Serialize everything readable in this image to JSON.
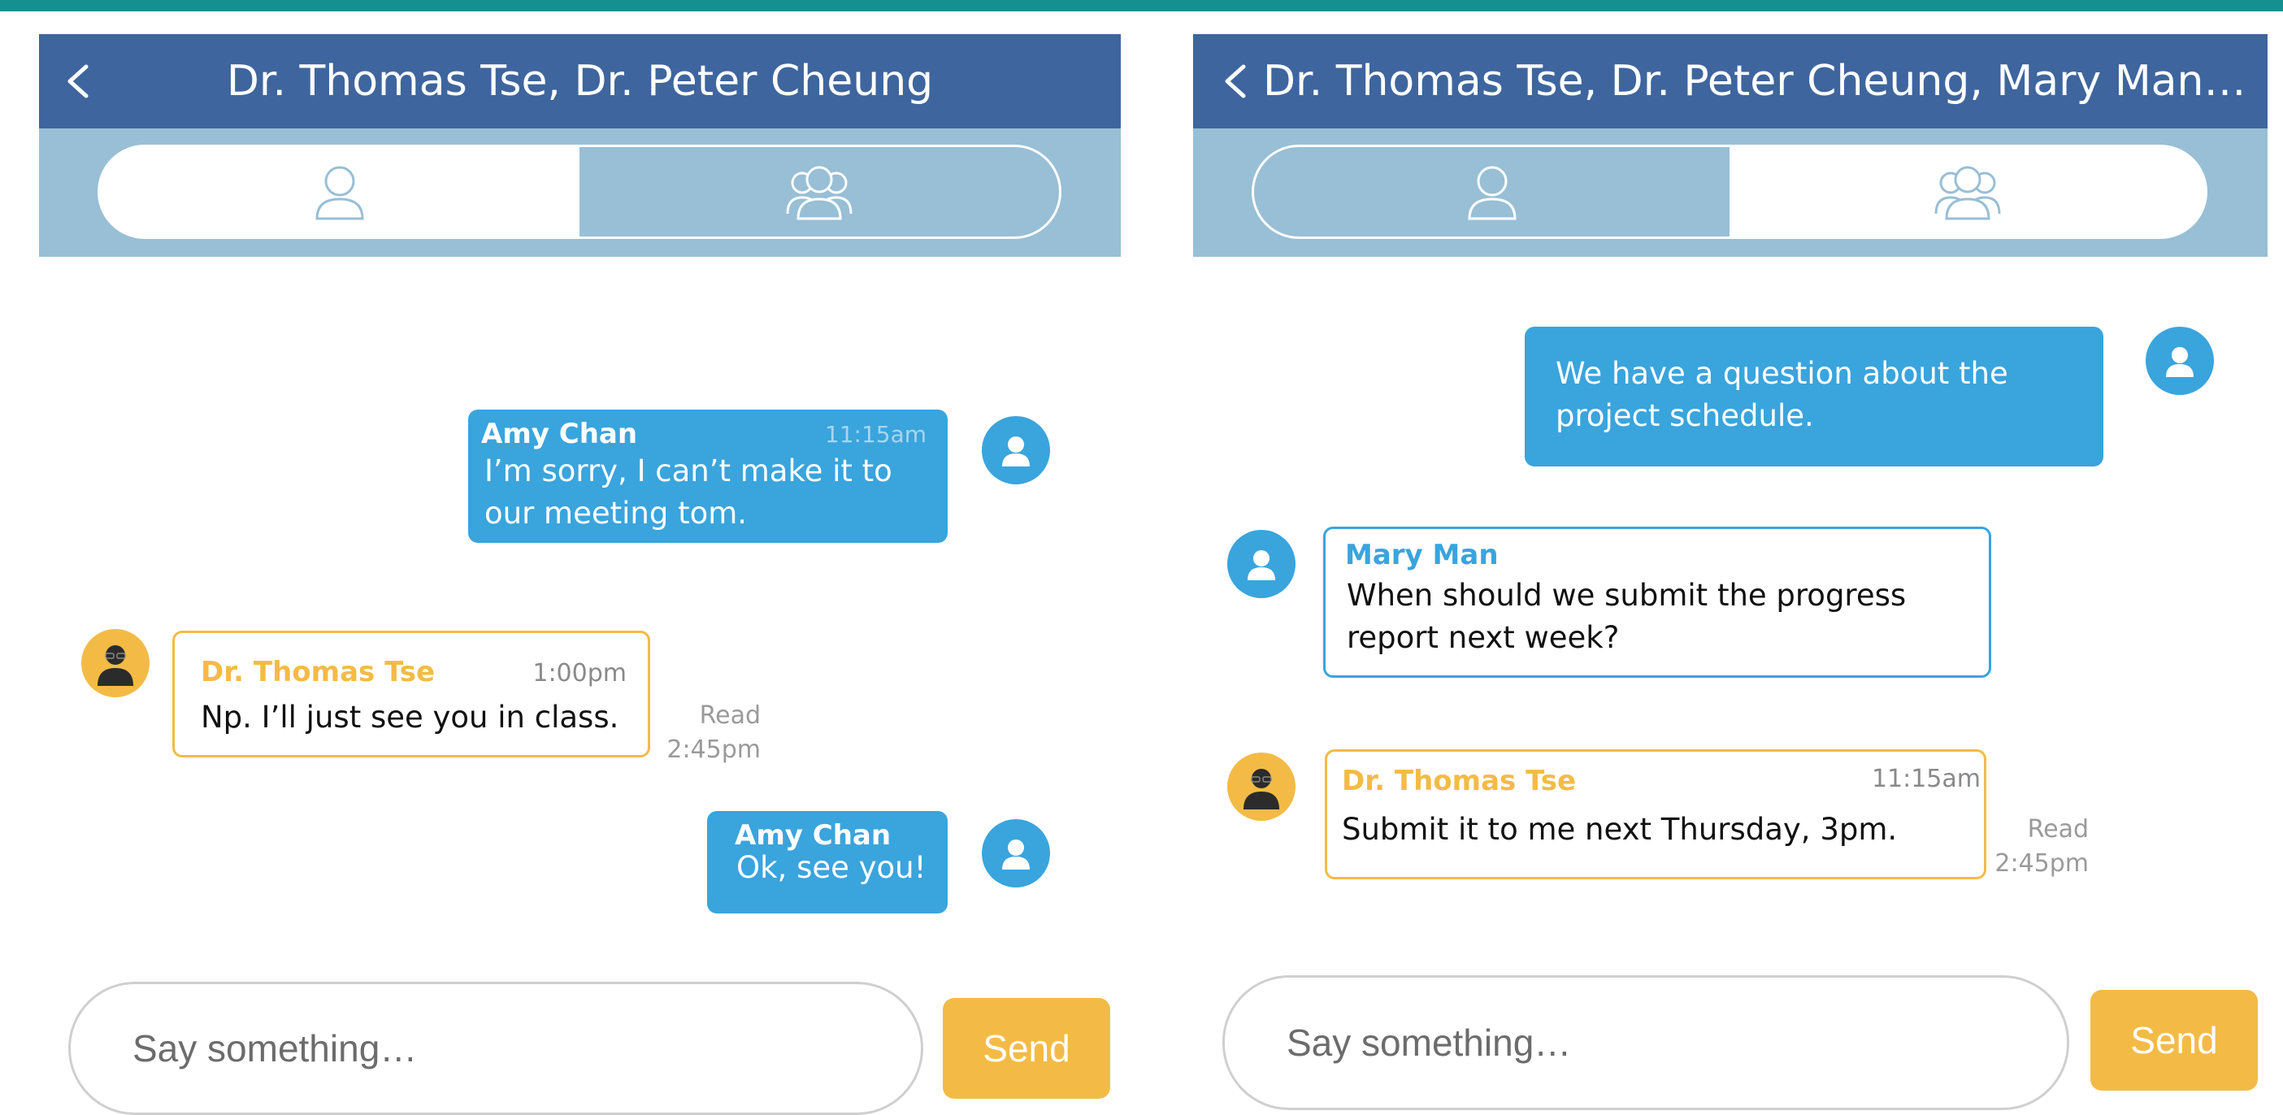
{
  "left_chat": {
    "title": "Dr. Thomas Tse, Dr. Peter Cheung",
    "tabs": [
      {
        "icon": "single-user-icon",
        "active": false
      },
      {
        "icon": "group-icon",
        "active": true
      }
    ],
    "messages": [
      {
        "sender": "Amy Chan",
        "time": "11:15am",
        "text": "I’m sorry, I can’t make it to our meeting tom.",
        "direction": "outgoing"
      },
      {
        "sender": "Dr. Thomas Tse",
        "time": "1:00pm",
        "text": "Np. I’ll just see you in class.",
        "direction": "incoming",
        "read_label": "Read",
        "read_time": "2:45pm"
      },
      {
        "sender": "Amy Chan",
        "text": "Ok, see you!",
        "direction": "outgoing"
      }
    ],
    "input_placeholder": "Say something…",
    "send_label": "Send"
  },
  "right_chat": {
    "title": "Dr. Thomas Tse, Dr. Peter Cheung, Mary Man…",
    "tabs": [
      {
        "icon": "single-user-icon",
        "active": true
      },
      {
        "icon": "group-icon",
        "active": false
      }
    ],
    "messages": [
      {
        "text": "We have a question about the project schedule.",
        "direction": "outgoing"
      },
      {
        "sender": "Mary Man",
        "text": "When should we submit the progress report next week?",
        "direction": "incoming"
      },
      {
        "sender": "Dr. Thomas Tse",
        "time": "11:15am",
        "text": "Submit it to me next Thursday, 3pm.",
        "direction": "incoming",
        "read_label": "Read",
        "read_time": "2:45pm"
      }
    ],
    "input_placeholder": "Say something…",
    "send_label": "Send"
  },
  "colors": {
    "top_bar": "#13908f",
    "header": "#3e659e",
    "sub_bar": "#98bfd5",
    "outgoing_bubble": "#3aa4dd",
    "gold_accent": "#f3bb46",
    "read_text": "#9a9a9a"
  }
}
